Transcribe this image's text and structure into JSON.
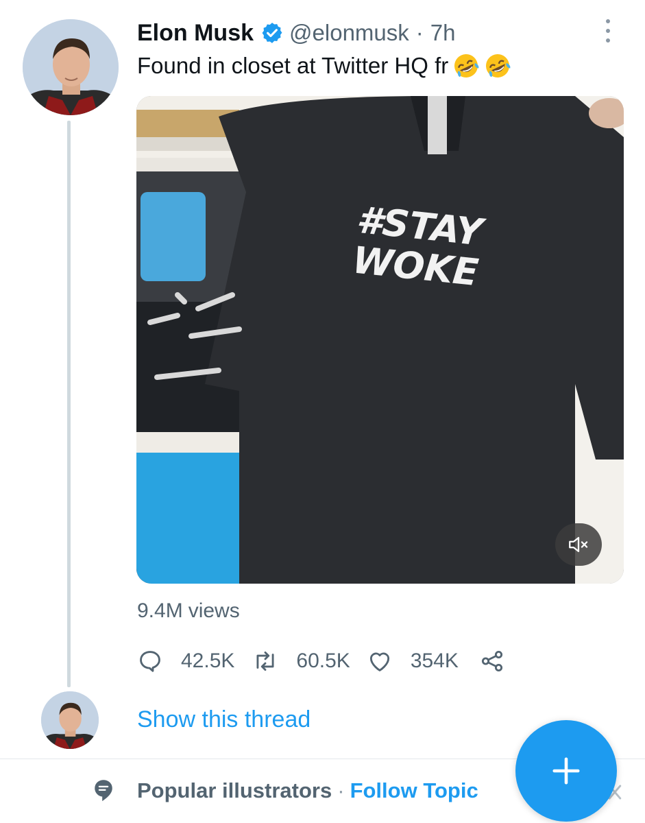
{
  "tweet": {
    "author_name": "Elon Musk",
    "handle": "@elonmusk",
    "separator": "·",
    "time": "7h",
    "text": "Found in closet at Twitter HQ fr",
    "emoji": [
      "rolling-on-floor-laughing-emoji",
      "rolling-on-floor-laughing-emoji"
    ],
    "media": {
      "type": "video",
      "shirt_print": [
        "#STAY",
        "WOKE"
      ],
      "muted": true
    },
    "views": {
      "count": "9.4M",
      "label": "views"
    },
    "actions": {
      "reply_count": "42.5K",
      "retweet_count": "60.5K",
      "like_count": "354K"
    }
  },
  "thread": {
    "link_label": "Show this thread"
  },
  "topic": {
    "name": "Popular illustrators",
    "separator": "·",
    "follow_label": "Follow Topic"
  },
  "icons": {
    "verified": "verified-badge-icon",
    "more": "more-options-icon",
    "mute": "speaker-muted-icon",
    "reply": "reply-icon",
    "retweet": "retweet-icon",
    "like": "heart-icon",
    "share": "share-icon",
    "topic": "topic-icon",
    "close": "close-icon",
    "compose": "plus-icon"
  },
  "colors": {
    "accent": "#1d9bf0",
    "text_primary": "#0f1419",
    "text_secondary": "#536471",
    "thread_line": "#cfd9de"
  }
}
